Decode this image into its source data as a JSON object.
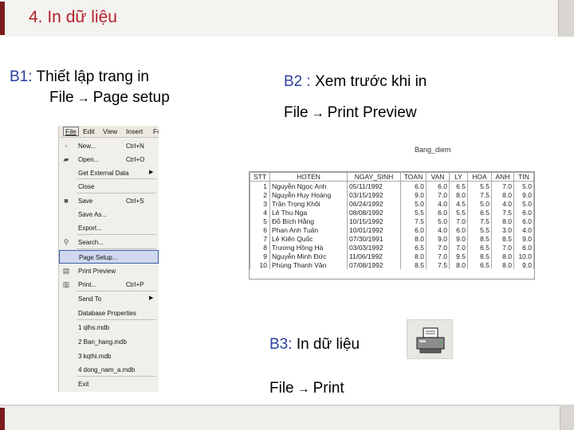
{
  "header": {
    "title": "4. In dữ liệu"
  },
  "step1": {
    "label": "B1:",
    "text": "Thiết lập trang in",
    "path_from": "File",
    "path_to": "Page setup"
  },
  "step2": {
    "label": "B2 :",
    "text": "Xem trước khi in",
    "path_from": "File",
    "path_to": "Print Preview"
  },
  "step3": {
    "label": "B3:",
    "text": "In dữ liệu",
    "path_from": "File",
    "path_to": "Print"
  },
  "menu": {
    "bar": [
      "File",
      "Edit",
      "View",
      "Insert",
      "Fo"
    ],
    "items": [
      {
        "icon": "new-doc-icon",
        "glyph": "▫",
        "label": "New...",
        "shortcut": "Ctrl+N"
      },
      {
        "icon": "open-folder-icon",
        "glyph": "▰",
        "label": "Open...",
        "shortcut": "Ctrl+O"
      },
      {
        "icon": "",
        "glyph": "",
        "label": "Get External Data",
        "shortcut": "",
        "submenu": true
      },
      {
        "icon": "",
        "glyph": "",
        "label": "Close",
        "shortcut": ""
      },
      {
        "icon": "save-icon",
        "glyph": "■",
        "label": "Save",
        "shortcut": "Ctrl+S"
      },
      {
        "icon": "",
        "glyph": "",
        "label": "Save As...",
        "shortcut": ""
      },
      {
        "icon": "",
        "glyph": "",
        "label": "Export...",
        "shortcut": ""
      },
      {
        "icon": "search-icon",
        "glyph": "⚲",
        "label": "Search...",
        "shortcut": ""
      },
      {
        "icon": "",
        "glyph": "",
        "label": "Page Setup...",
        "shortcut": "",
        "highlighted": true
      },
      {
        "icon": "print-preview-icon",
        "glyph": "▤",
        "label": "Print Preview",
        "shortcut": ""
      },
      {
        "icon": "printer-icon",
        "glyph": "▥",
        "label": "Print...",
        "shortcut": "Ctrl+P"
      },
      {
        "icon": "",
        "glyph": "",
        "label": "Send To",
        "shortcut": "",
        "submenu": true
      },
      {
        "icon": "",
        "glyph": "",
        "label": "Database Properties",
        "shortcut": ""
      },
      {
        "icon": "",
        "glyph": "",
        "label": "1 qlhs.mdb",
        "shortcut": ""
      },
      {
        "icon": "",
        "glyph": "",
        "label": "2 Ban_hang.mdb",
        "shortcut": ""
      },
      {
        "icon": "",
        "glyph": "",
        "label": "3 kqthi.mdb",
        "shortcut": ""
      },
      {
        "icon": "",
        "glyph": "",
        "label": "4 dong_nam_a.mdb",
        "shortcut": ""
      },
      {
        "icon": "",
        "glyph": "",
        "label": "Exit",
        "shortcut": ""
      }
    ]
  },
  "report": {
    "title": "Bang_diem",
    "columns": [
      "STT",
      "HOTEN",
      "NGAY_SINH",
      "TOAN",
      "VAN",
      "LY",
      "HOA",
      "ANH",
      "TIN"
    ],
    "rows": [
      [
        "1",
        "Nguyễn Ngọc Anh",
        "05/11/1992",
        "6.0",
        "6.0",
        "6.5",
        "5.5",
        "7.0",
        "5.0"
      ],
      [
        "2",
        "Nguyễn Huy Hoàng",
        "03/15/1992",
        "9.0",
        "7.0",
        "8.0",
        "7.5",
        "8.0",
        "9.0"
      ],
      [
        "3",
        "Trần Trọng Khôi",
        "06/24/1992",
        "5.0",
        "4.0",
        "4.5",
        "5.0",
        "4.0",
        "5.0"
      ],
      [
        "4",
        "Lê Thu Nga",
        "08/08/1992",
        "5.5",
        "6.0",
        "5.5",
        "6.5",
        "7.5",
        "6.0"
      ],
      [
        "5",
        "Đỗ Bích Hằng",
        "10/15/1992",
        "7.5",
        "5.0",
        "7.0",
        "7.5",
        "8.0",
        "6.0"
      ],
      [
        "6",
        "Phan Anh Tuấn",
        "10/01/1992",
        "6.0",
        "4.0",
        "6.0",
        "5.5",
        "3.0",
        "4.0"
      ],
      [
        "7",
        "Lê Kiến Quốc",
        "07/30/1991",
        "8.0",
        "9.0",
        "9.0",
        "8.5",
        "8.5",
        "9.0"
      ],
      [
        "8",
        "Trương Hồng Hà",
        "03/03/1992",
        "6.5",
        "7.0",
        "7.0",
        "6.5",
        "7.0",
        "6.0"
      ],
      [
        "9",
        "Nguyễn Minh Đức",
        "11/06/1992",
        "8.0",
        "7.0",
        "9.5",
        "8.5",
        "8.0",
        "10.0"
      ],
      [
        "10",
        "Phùng Thanh Vân",
        "07/08/1992",
        "8.5",
        "7.5",
        "8.0",
        "6.5",
        "8.0",
        "9.0"
      ]
    ]
  }
}
